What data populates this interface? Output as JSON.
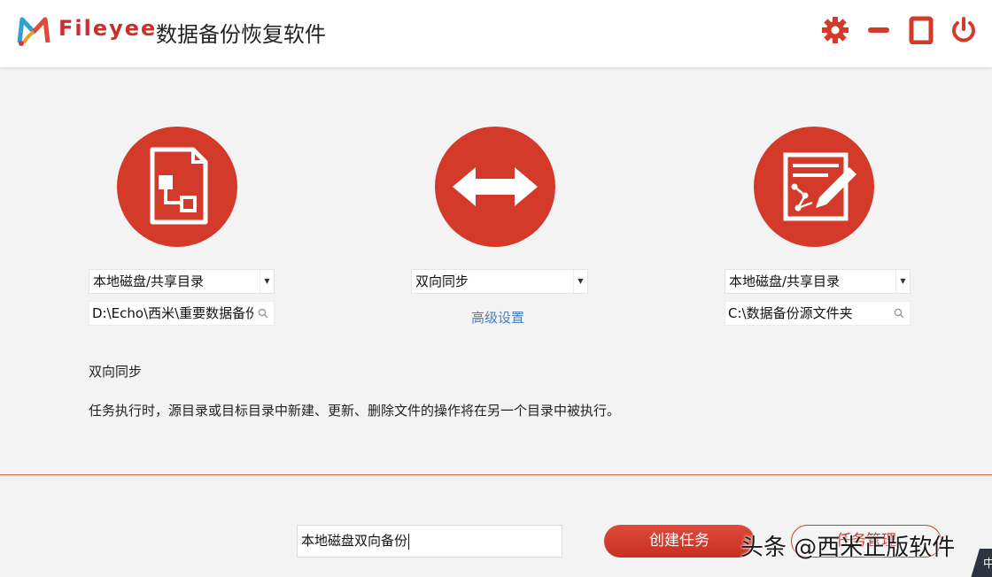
{
  "titlebar": {
    "brand": "Fileyee",
    "title": "数据备份恢复软件"
  },
  "icons": {
    "settings": "gear-icon",
    "minimize": "minimize-icon",
    "maximize": "maximize-icon",
    "close": "power-icon",
    "source": "document-flow-icon",
    "sync": "double-arrow-icon",
    "target": "edit-document-icon"
  },
  "colors": {
    "accent": "#d33a2a",
    "link": "#4a7fb5"
  },
  "source": {
    "type_label": "本地磁盘/共享目录",
    "path": "D:\\Echo\\西米\\重要数据备份"
  },
  "mode": {
    "selected": "双向同步",
    "advanced_label": "高级设置"
  },
  "target": {
    "type_label": "本地磁盘/共享目录",
    "path": "C:\\数据备份源文件夹"
  },
  "description": {
    "title": "双向同步",
    "text": "任务执行时，源目录或目标目录中新建、更新、删除文件的操作将在另一个目录中被执行。"
  },
  "footer": {
    "task_name": "本地磁盘双向备份",
    "create_label": "创建任务",
    "second_label": "任务管理"
  },
  "watermark": {
    "text": "头条 @西米正版软件",
    "corner": "中"
  }
}
